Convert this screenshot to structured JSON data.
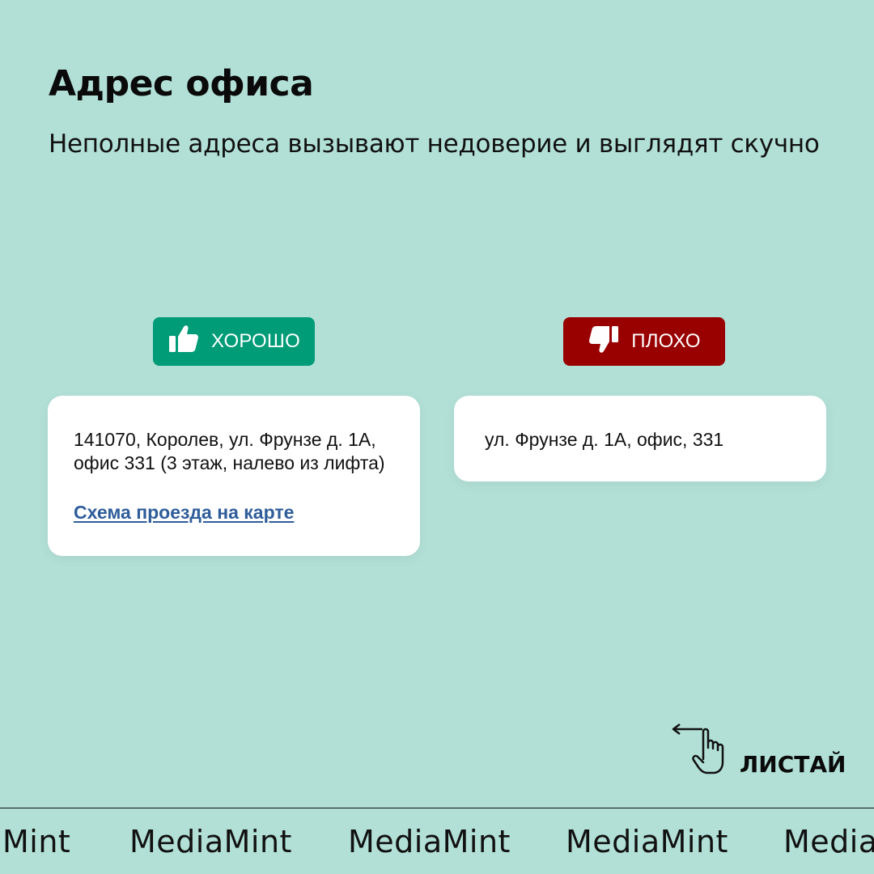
{
  "header": {
    "title": "Адрес офиса",
    "subtitle": "Неполные адреса вызывают недоверие и выглядят скучно"
  },
  "good": {
    "badge_label": "ХОРОШО",
    "badge_icon": "thumbs-up-icon",
    "badge_color": "#009b77",
    "address_line1": "141070, Королев, ул. Фрунзе д. 1А,",
    "address_line2": "офис 331 (3 этаж, налево из лифта)",
    "map_link": "Схема проезда на карте"
  },
  "bad": {
    "badge_label": "ПЛОХО",
    "badge_icon": "thumbs-down-icon",
    "badge_color": "#990000",
    "address": "ул. Фрунзе д. 1А, офис, 331"
  },
  "swipe": {
    "label": "ЛИСТАЙ",
    "icon": "swipe-hand-icon"
  },
  "ticker": {
    "items": [
      "Mint",
      "MediaMint",
      "MediaMint",
      "MediaMint",
      "Media"
    ]
  },
  "colors": {
    "background": "#b2e0d7",
    "link": "#2f5d9a"
  }
}
